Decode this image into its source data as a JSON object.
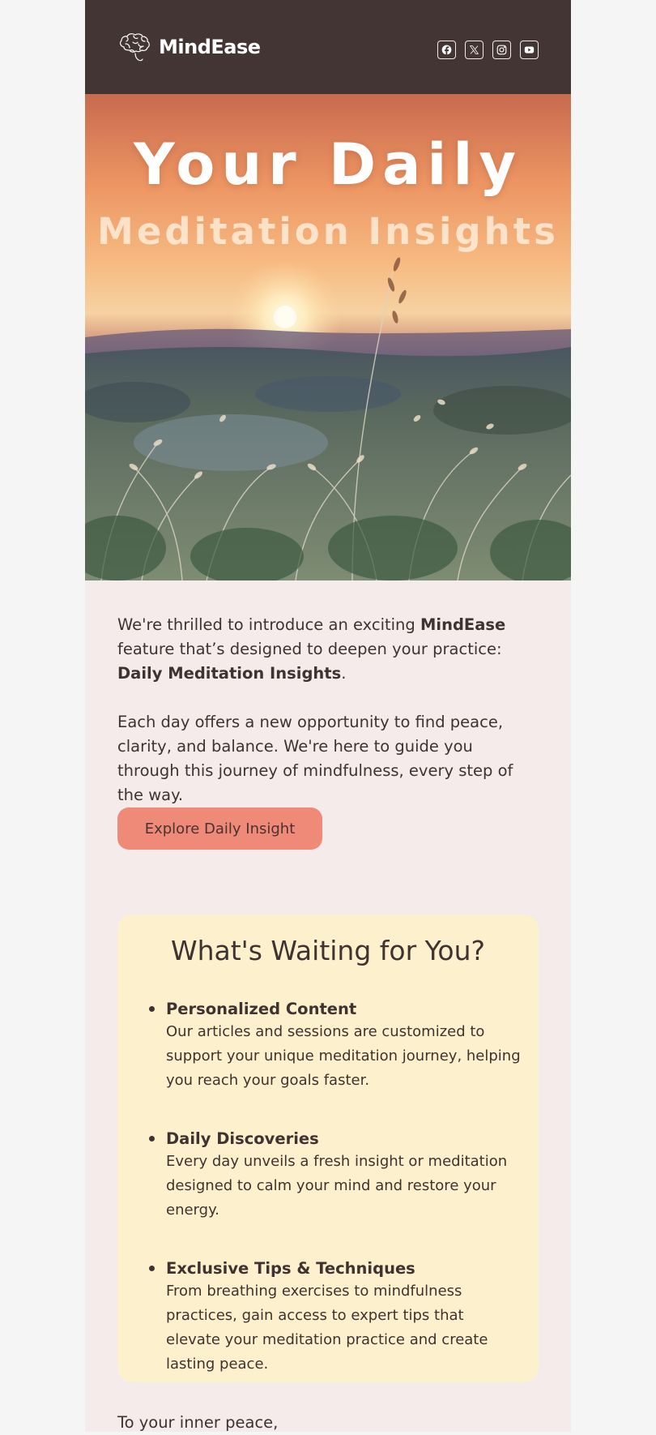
{
  "brand": {
    "name": "MindEase",
    "logo_icon": "brain-icon"
  },
  "header": {
    "socials": [
      {
        "name": "facebook-icon"
      },
      {
        "name": "x-icon"
      },
      {
        "name": "instagram-icon"
      },
      {
        "name": "youtube-icon"
      }
    ]
  },
  "hero": {
    "line1": "Your Daily",
    "line2": "Meditation Insights"
  },
  "intro": {
    "p1_a": "We're thrilled to introduce an exciting ",
    "p1_brand": "MindEase",
    "p1_b": " feature that’s designed to deepen your practice: ",
    "p1_feature": "Daily Meditation Insights",
    "p1_c": ".",
    "p2": "Each day offers a new opportunity to find peace, clarity, and balance. We're here to guide you through this journey of mindfulness, every step of the way."
  },
  "cta": {
    "label": "Explore Daily Insight"
  },
  "card": {
    "title": "What's Waiting for You?",
    "features": [
      {
        "title": "Personalized Content",
        "desc": "Our articles and sessions are customized to support your unique meditation journey, helping you reach your goals faster."
      },
      {
        "title": "Daily Discoveries",
        "desc": "Every day unveils a fresh insight or meditation designed to calm your mind and restore your energy."
      },
      {
        "title": "Exclusive Tips &  Techniques",
        "desc": "From breathing exercises to mindfulness practices, gain access to expert tips that elevate your meditation practice and create lasting peace."
      }
    ]
  },
  "signoff": {
    "text": "To your inner peace,"
  },
  "colors": {
    "header_bg": "#433534",
    "page_bg": "#f4ebea",
    "cta_bg": "#ef8a78",
    "card_bg": "#fdf0cc",
    "text": "#3e3331"
  }
}
